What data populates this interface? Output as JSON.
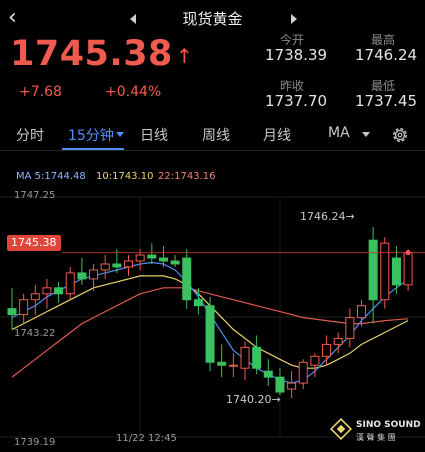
{
  "nav": {
    "title": "现货黄金"
  },
  "quote": {
    "price": "1745.38",
    "change": "+7.68",
    "change_pct": "+0.44%",
    "open_label": "今开",
    "open": "1738.39",
    "high_label": "最高",
    "high": "1746.24",
    "prev_close_label": "昨收",
    "prev_close": "1737.70",
    "low_label": "最低",
    "low": "1737.45"
  },
  "tabs": [
    {
      "label": "分时"
    },
    {
      "label": "15分钟"
    },
    {
      "label": "日线"
    },
    {
      "label": "周线"
    },
    {
      "label": "月线"
    },
    {
      "label": "MA"
    }
  ],
  "ma_legend": {
    "ma5": "MA 5:1744.48",
    "ma10": "10:1743.10",
    "ma22": "22:1743.16"
  },
  "axis": {
    "top": "1747.25",
    "mid": "1743.22",
    "bottom": "1739.19",
    "time": "11/22 12:45"
  },
  "annotations": {
    "price_tag": "1745.38",
    "high_mark": "1746.24→",
    "low_mark": "1740.20→"
  },
  "watermark": {
    "line1": "SINO SOUND",
    "line2": "漢 聲 集 團"
  },
  "colors": {
    "up": "#f15a4e",
    "down": "#3bc15f",
    "ma5": "#4a8ff0",
    "ma10": "#e8d36a",
    "ma22": "#e05a4e",
    "accent": "#4f8ff7"
  },
  "chart_data": {
    "type": "candlestick",
    "ylim": [
      1739.19,
      1747.25
    ],
    "ohlc": [
      [
        1743.5,
        1744.2,
        1742.8,
        1743.3
      ],
      [
        1743.3,
        1744.0,
        1743.0,
        1743.8
      ],
      [
        1743.8,
        1744.3,
        1743.3,
        1744.0
      ],
      [
        1744.0,
        1744.5,
        1743.5,
        1744.2
      ],
      [
        1744.2,
        1744.4,
        1743.7,
        1744.0
      ],
      [
        1744.0,
        1744.9,
        1743.8,
        1744.7
      ],
      [
        1744.7,
        1745.2,
        1744.3,
        1744.5
      ],
      [
        1744.5,
        1745.0,
        1744.1,
        1744.8
      ],
      [
        1744.8,
        1745.3,
        1744.5,
        1745.0
      ],
      [
        1745.0,
        1745.5,
        1744.7,
        1744.9
      ],
      [
        1744.9,
        1745.3,
        1744.6,
        1745.1
      ],
      [
        1745.1,
        1745.5,
        1744.8,
        1745.3
      ],
      [
        1745.3,
        1745.7,
        1745.0,
        1745.2
      ],
      [
        1745.2,
        1745.6,
        1744.9,
        1745.1
      ],
      [
        1745.1,
        1745.3,
        1744.9,
        1745.0
      ],
      [
        1745.2,
        1745.5,
        1743.5,
        1743.8
      ],
      [
        1743.8,
        1744.2,
        1743.3,
        1743.6
      ],
      [
        1743.6,
        1743.9,
        1741.4,
        1741.7
      ],
      [
        1741.7,
        1742.3,
        1741.2,
        1741.6
      ],
      [
        1741.6,
        1742.0,
        1741.2,
        1741.6
      ],
      [
        1741.5,
        1742.4,
        1741.1,
        1742.2
      ],
      [
        1742.2,
        1742.6,
        1741.3,
        1741.5
      ],
      [
        1741.4,
        1741.8,
        1740.9,
        1741.2
      ],
      [
        1741.2,
        1741.5,
        1740.6,
        1740.7
      ],
      [
        1740.8,
        1741.4,
        1740.5,
        1741.0
      ],
      [
        1741.0,
        1741.8,
        1740.8,
        1741.7
      ],
      [
        1741.6,
        1742.0,
        1741.2,
        1741.9
      ],
      [
        1741.9,
        1742.6,
        1741.6,
        1742.3
      ],
      [
        1742.3,
        1742.7,
        1742.0,
        1742.5
      ],
      [
        1742.5,
        1743.5,
        1742.2,
        1743.2
      ],
      [
        1743.2,
        1743.8,
        1742.9,
        1743.6
      ],
      [
        1745.8,
        1746.24,
        1743.0,
        1743.8
      ],
      [
        1743.8,
        1745.9,
        1743.5,
        1745.7
      ],
      [
        1745.2,
        1745.6,
        1744.0,
        1744.3
      ],
      [
        1744.3,
        1745.5,
        1744.1,
        1745.38
      ]
    ],
    "ma5": [
      1743.2,
      1743.4,
      1743.6,
      1743.9,
      1744.1,
      1744.3,
      1744.5,
      1744.6,
      1744.7,
      1744.8,
      1744.9,
      1745.0,
      1745.05,
      1745.0,
      1744.8,
      1744.4,
      1743.9,
      1743.3,
      1742.7,
      1742.1,
      1741.8,
      1741.5,
      1741.3,
      1741.1,
      1741.0,
      1741.1,
      1741.4,
      1741.8,
      1742.2,
      1742.6,
      1743.1,
      1743.5,
      1743.9,
      1744.2,
      1744.48
    ],
    "ma10": [
      1742.8,
      1743.0,
      1743.2,
      1743.4,
      1743.6,
      1743.8,
      1744.0,
      1744.2,
      1744.3,
      1744.4,
      1744.5,
      1744.6,
      1744.6,
      1744.6,
      1744.5,
      1744.3,
      1744.0,
      1743.6,
      1743.2,
      1742.8,
      1742.5,
      1742.2,
      1742.0,
      1741.8,
      1741.6,
      1741.5,
      1741.5,
      1741.6,
      1741.8,
      1742.0,
      1742.3,
      1742.5,
      1742.7,
      1742.9,
      1743.1
    ],
    "ma22": [
      1741.2,
      1741.5,
      1741.8,
      1742.1,
      1742.4,
      1742.7,
      1743.0,
      1743.2,
      1743.4,
      1743.6,
      1743.8,
      1744.0,
      1744.1,
      1744.2,
      1744.2,
      1744.2,
      1744.1,
      1744.0,
      1743.9,
      1743.8,
      1743.7,
      1743.6,
      1743.5,
      1743.4,
      1743.3,
      1743.2,
      1743.15,
      1743.1,
      1743.05,
      1743.0,
      1743.0,
      1743.05,
      1743.1,
      1743.13,
      1743.16
    ]
  }
}
